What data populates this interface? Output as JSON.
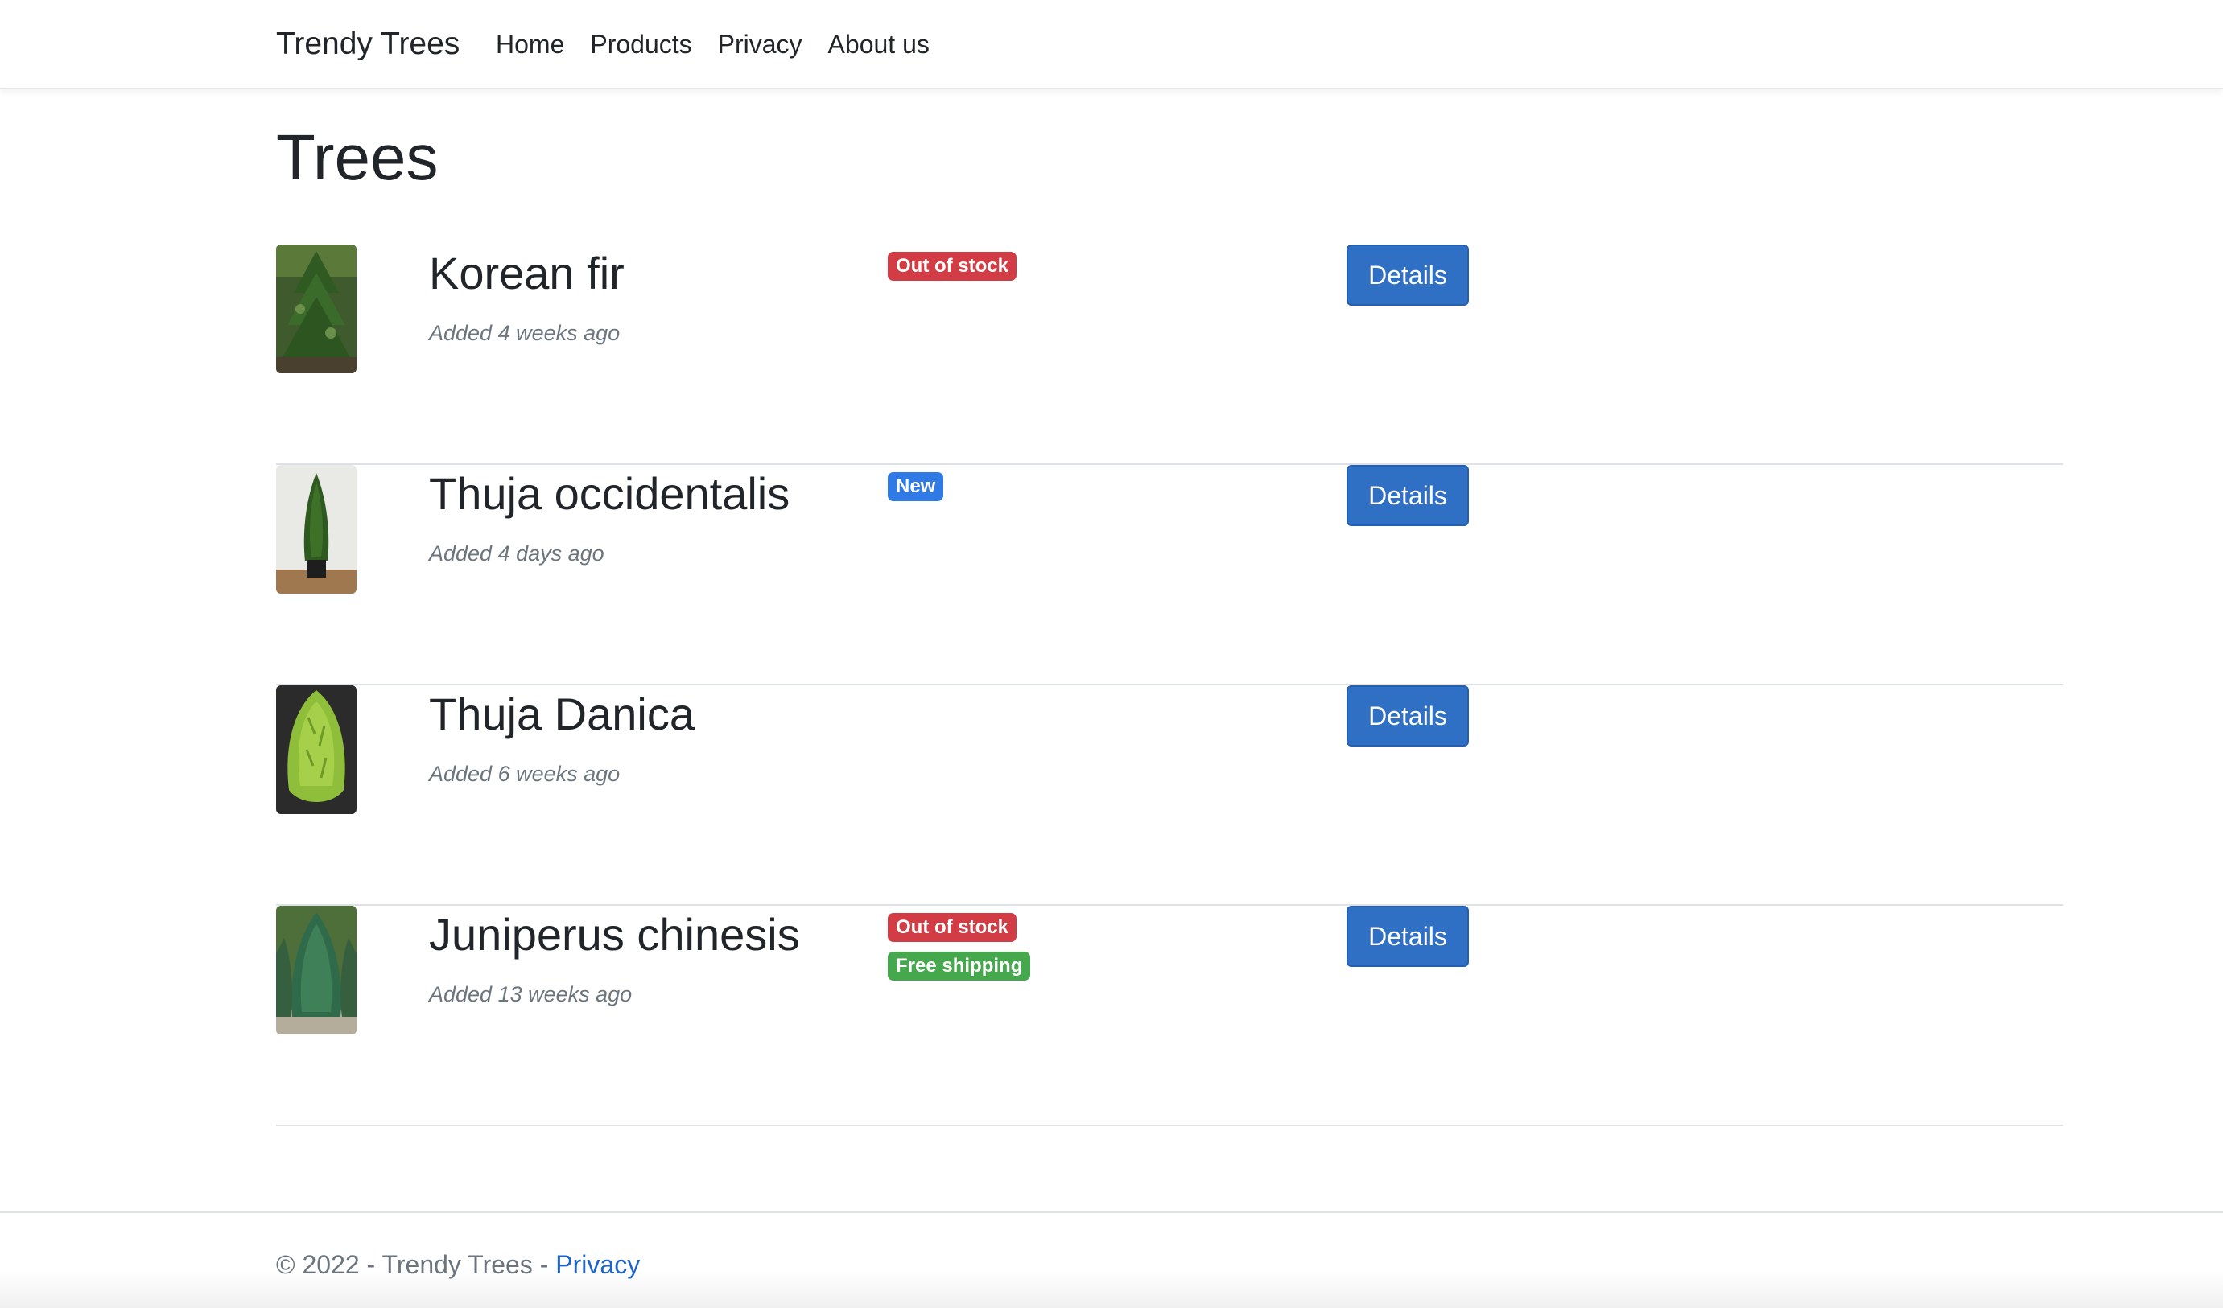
{
  "navbar": {
    "brand": "Trendy Trees",
    "links": [
      "Home",
      "Products",
      "Privacy",
      "About us"
    ]
  },
  "page": {
    "title": "Trees"
  },
  "products": [
    {
      "name": "Korean fir",
      "added": "Added 4 weeks ago",
      "badges": [
        {
          "label": "Out of stock",
          "variant": "danger"
        }
      ],
      "button": "Details",
      "image": "korean-fir-photo"
    },
    {
      "name": "Thuja occidentalis",
      "added": "Added 4 days ago",
      "badges": [
        {
          "label": "New",
          "variant": "primary"
        }
      ],
      "button": "Details",
      "image": "thuja-occidentalis-photo"
    },
    {
      "name": "Thuja Danica",
      "added": "Added 6 weeks ago",
      "badges": [],
      "button": "Details",
      "image": "thuja-danica-photo"
    },
    {
      "name": "Juniperus chinesis",
      "added": "Added 13 weeks ago",
      "badges": [
        {
          "label": "Out of stock",
          "variant": "danger"
        },
        {
          "label": "Free shipping",
          "variant": "success"
        }
      ],
      "button": "Details",
      "image": "juniperus-chinesis-photo"
    }
  ],
  "footer": {
    "text": "© 2022 - Trendy Trees - ",
    "link": "Privacy"
  },
  "colors": {
    "primary_button": "#2f6fc4",
    "badge_danger": "#d13c45",
    "badge_primary": "#2f7ae5",
    "badge_success": "#46a84d",
    "link": "#1f63c8"
  }
}
